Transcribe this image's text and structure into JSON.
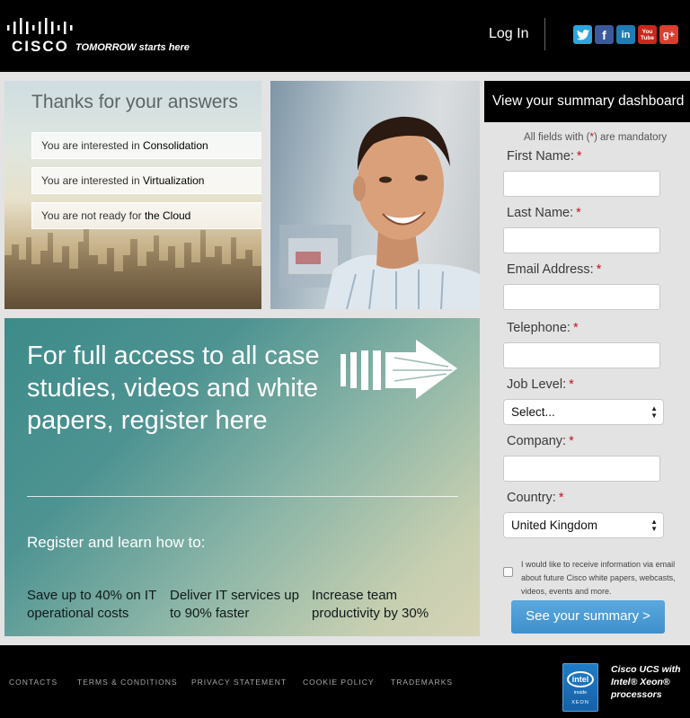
{
  "header": {
    "logo_text": "CISCO",
    "tagline": "TOMORROW starts here",
    "login_label": "Log In",
    "social": [
      {
        "name": "twitter-icon",
        "glyph": "t",
        "color": "#2da6e0"
      },
      {
        "name": "facebook-icon",
        "glyph": "f",
        "color": "#3b5a9a"
      },
      {
        "name": "linkedin-icon",
        "glyph": "in",
        "color": "#1f7cb5"
      },
      {
        "name": "youtube-icon",
        "glyph": "You Tube",
        "color": "#c9281e"
      },
      {
        "name": "googleplus-icon",
        "glyph": "g+",
        "color": "#d9402e"
      }
    ]
  },
  "answers": {
    "title": "Thanks for your answers",
    "items": [
      {
        "prefix": "You are interested in ",
        "topic": "Consolidation"
      },
      {
        "prefix": "You are interested in ",
        "topic": "Virtualization"
      },
      {
        "prefix": "You are not ready for ",
        "topic": "the Cloud"
      }
    ]
  },
  "register": {
    "headline": "For full access to all case studies, videos and white papers, register here",
    "subheading": "Register and learn how to:",
    "benefits": [
      "Save up to 40% on IT operational costs",
      "Deliver IT services up to 90% faster",
      "Increase team productivity by 30%"
    ]
  },
  "form": {
    "title": "View your summary dashboard",
    "mandatory_prefix": "All fields with (",
    "mandatory_star": "*",
    "mandatory_suffix": ") are mandatory",
    "required_marker": "*",
    "fields": {
      "first_name": {
        "label": "First Name:",
        "value": ""
      },
      "last_name": {
        "label": "Last Name:",
        "value": ""
      },
      "email": {
        "label": "Email Address:",
        "value": ""
      },
      "telephone": {
        "label": "Telephone:",
        "value": ""
      },
      "job_level": {
        "label": "Job Level:",
        "value": "Select..."
      },
      "company": {
        "label": "Company:",
        "value": ""
      },
      "country": {
        "label": "Country:",
        "value": "United Kingdom"
      }
    },
    "consent_text": "I would like to receive information via email about future Cisco white papers, webcasts, videos, events and more.",
    "consent_checked": false,
    "submit_label": "See your summary >"
  },
  "footer": {
    "links": [
      "CONTACTS",
      "TERMS & CONDITIONS",
      "PRIVACY STATEMENT",
      "COOKIE POLICY",
      "TRADEMARKS"
    ],
    "intel_logo": "intel",
    "intel_inside": "inside",
    "intel_xeon": "XEON",
    "promo_text": "Cisco UCS with Intel® Xeon® processors"
  },
  "colors": {
    "header_bg": "#000000",
    "content_bg": "#e3e3e3",
    "accent_button": "#4a9ad4",
    "required_red": "#c0161d"
  }
}
